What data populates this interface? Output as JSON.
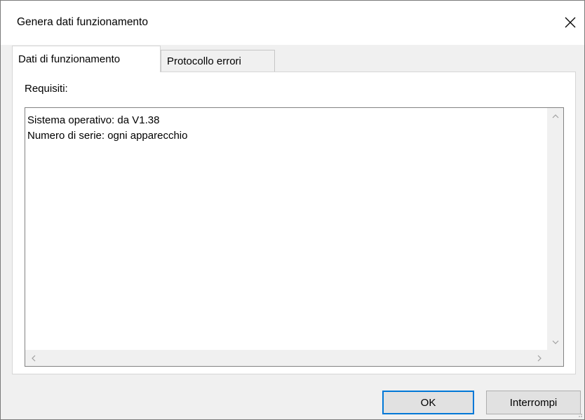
{
  "window": {
    "title": "Genera dati funzionamento"
  },
  "tabs": [
    {
      "label": "Dati di funzionamento",
      "active": true
    },
    {
      "label": "Protocollo errori",
      "active": false
    }
  ],
  "panel": {
    "requirements_label": "Requisiti:",
    "requirements_text": "Sistema operativo: da V1.38\nNumero di serie: ogni apparecchio"
  },
  "buttons": {
    "ok_label": "OK",
    "cancel_label": "Interrompi"
  },
  "icons": {
    "close": "close-icon",
    "scroll_up": "chevron-up-icon",
    "scroll_down": "chevron-down-icon",
    "scroll_left": "chevron-left-icon",
    "scroll_right": "chevron-right-icon"
  },
  "colors": {
    "accent": "#0078d7",
    "dialog_bg": "#f0f0f0",
    "button_bg": "#e1e1e1"
  }
}
